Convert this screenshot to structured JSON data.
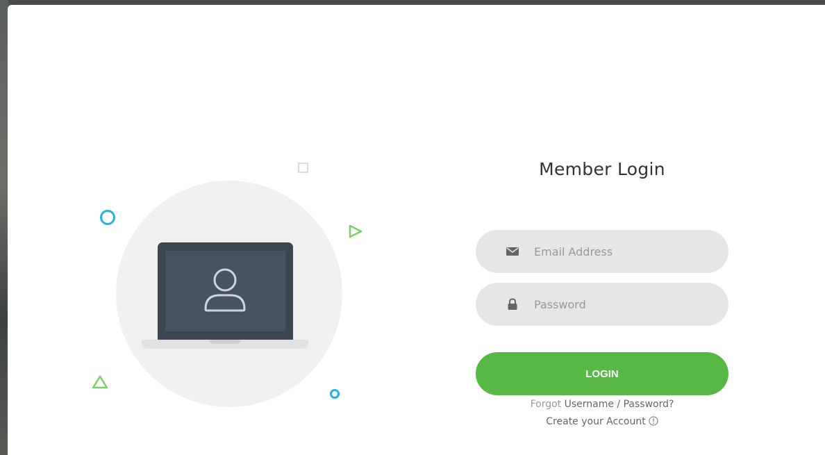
{
  "login": {
    "title": "Member Login",
    "email": {
      "placeholder": "Email Address",
      "icon": "envelope-icon"
    },
    "password": {
      "placeholder": "Password",
      "icon": "lock-icon"
    },
    "submit_label": "LOGIN",
    "forgot_prefix": "Forgot",
    "forgot_link": "Username / Password?",
    "create_link": "Create your Account",
    "create_icon": "info-circle-icon"
  },
  "colors": {
    "accent_green": "#57b846",
    "accent_blue": "#1fb6de",
    "field_bg": "#e6e6e6",
    "laptop_dark": "#3b4650"
  }
}
